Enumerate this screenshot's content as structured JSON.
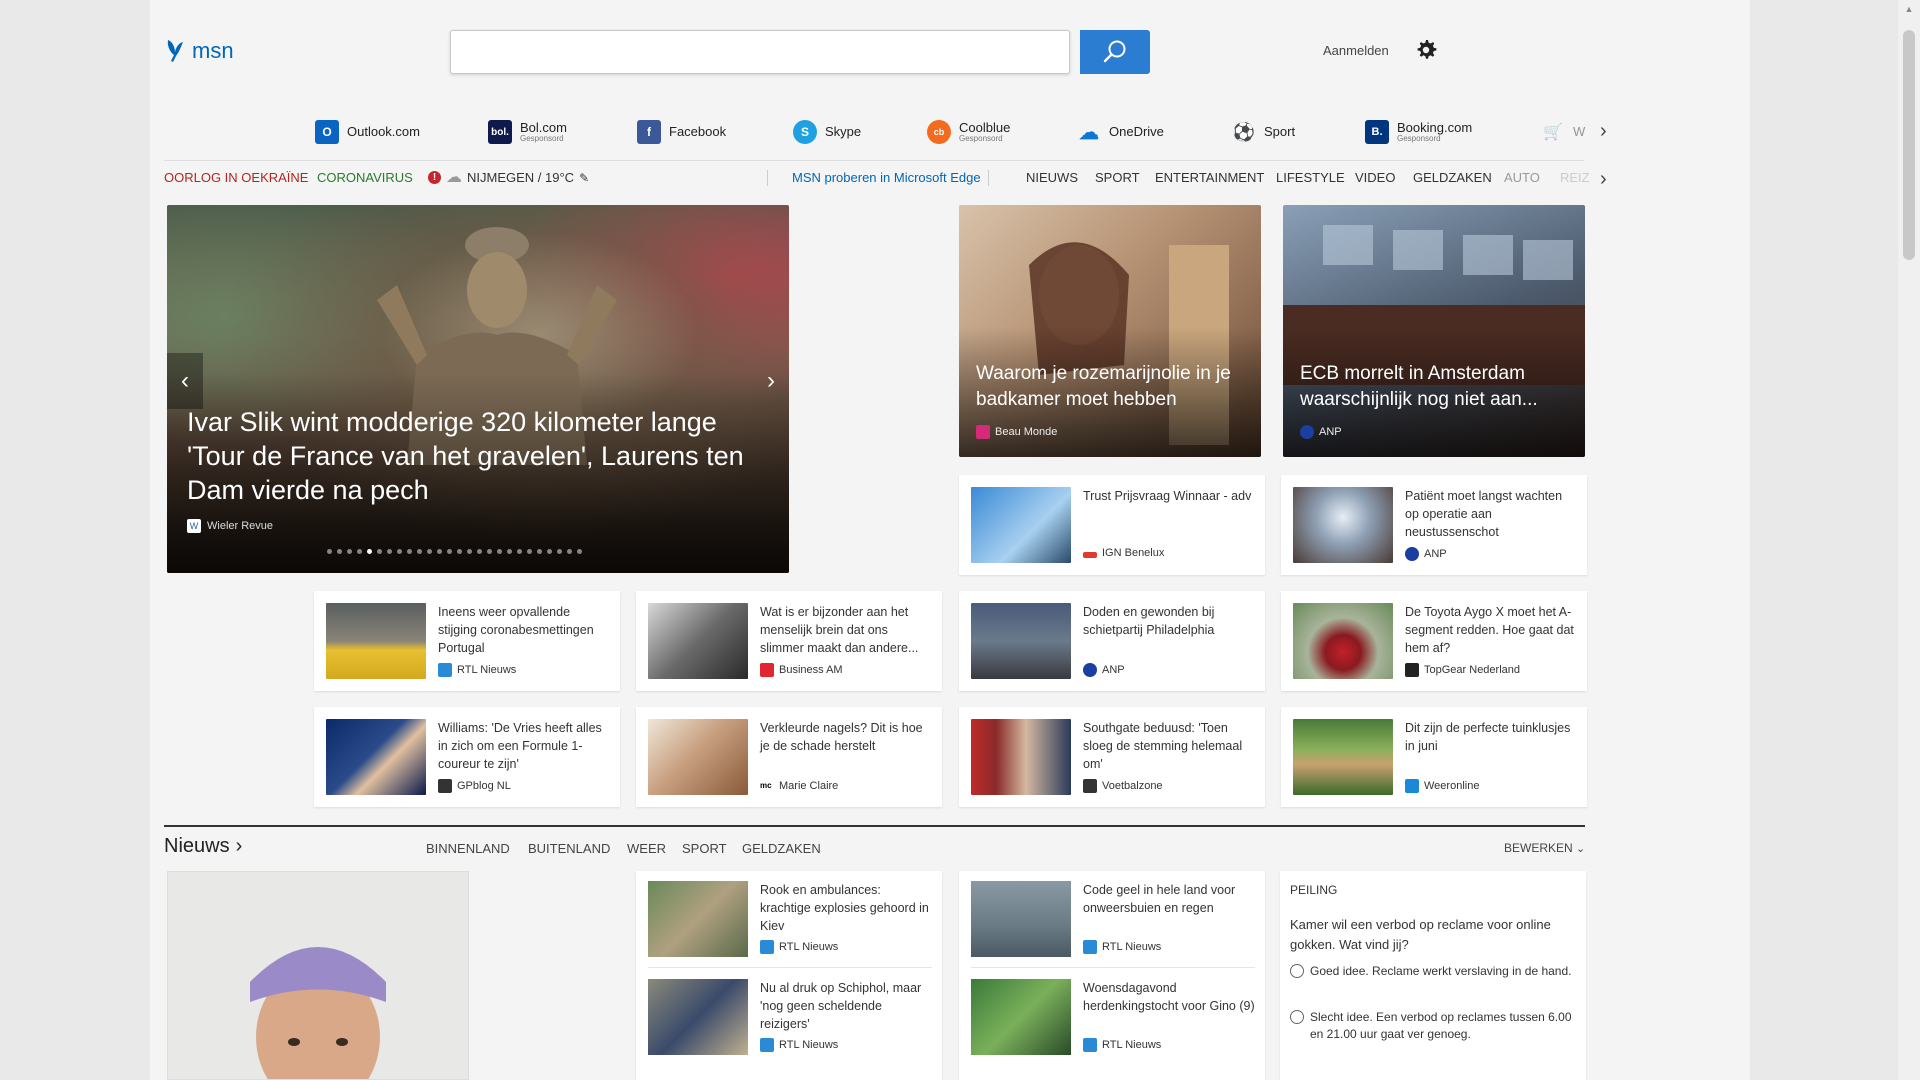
{
  "header": {
    "logo_text": "msn",
    "search_placeholder": "",
    "signin_label": "Aanmelden"
  },
  "quick_links": [
    {
      "label": "Outlook.com",
      "sub": "",
      "icon": "outlook-icon",
      "color": "#0a64c2"
    },
    {
      "label": "Bol.com",
      "sub": "Gesponsord",
      "icon": "bol-icon",
      "color": "#0e1a4d",
      "glyph": "bol."
    },
    {
      "label": "Facebook",
      "sub": "",
      "icon": "facebook-icon",
      "color": "#3b5998",
      "glyph": "f"
    },
    {
      "label": "Skype",
      "sub": "",
      "icon": "skype-icon",
      "color": "#1ea1e3",
      "glyph": "S"
    },
    {
      "label": "Coolblue",
      "sub": "Gesponsord",
      "icon": "coolblue-icon",
      "color": "#f26b1f",
      "glyph": "cb"
    },
    {
      "label": "OneDrive",
      "sub": "",
      "icon": "onedrive-icon",
      "color": "#0a78d4",
      "glyph": "☁"
    },
    {
      "label": "Sport",
      "sub": "",
      "icon": "sport-icon",
      "color": "#2a5aa8",
      "glyph": "⚽"
    },
    {
      "label": "Booking.com",
      "sub": "Gesponsord",
      "icon": "booking-icon",
      "color": "#003580",
      "glyph": "B."
    },
    {
      "label": "W",
      "sub": "",
      "icon": "cart-icon",
      "color": "#6aa6e0",
      "glyph": "🛒"
    }
  ],
  "nav": {
    "ukraine": "OORLOG IN OEKRAÏNE",
    "corona": "CORONAVIRUS",
    "weather": "NIJMEGEN / 19°C",
    "edge_promo": "MSN proberen in Microsoft Edge",
    "items": [
      "NIEUWS",
      "SPORT",
      "ENTERTAINMENT",
      "LIFESTYLE",
      "VIDEO",
      "GELDZAKEN",
      "AUTO",
      "REIZ"
    ]
  },
  "hero": {
    "title": "Ivar Slik wint modderige 320 kilometer lange 'Tour de France van het gravelen', Laurens ten Dam vierde na pech",
    "source": "Wieler Revue",
    "slide_count": 26,
    "active_slide": 4
  },
  "top_cards": [
    {
      "title": "Waarom je rozemarijnolie in je badkamer moet hebben",
      "source": "Beau Monde"
    },
    {
      "title": "ECB morrelt in Amsterdam waarschijnlijk nog niet aan...",
      "source": "ANP"
    }
  ],
  "cards": [
    {
      "title": "Trust Prijsvraag Winnaar - adv",
      "source": "IGN Benelux"
    },
    {
      "title": "Patiënt moet langst wachten op operatie aan neustussenschot",
      "source": "ANP"
    },
    {
      "title": "Ineens weer opvallende stijging coronabesmettingen Portugal",
      "source": "RTL Nieuws"
    },
    {
      "title": "Wat is er bijzonder aan het menselijk brein dat ons slimmer maakt dan andere...",
      "source": "Business AM"
    },
    {
      "title": "Doden en gewonden bij schietpartij Philadelphia",
      "source": "ANP"
    },
    {
      "title": "De Toyota Aygo X moet het A-segment redden. Hoe gaat dat hem af?",
      "source": "TopGear Nederland"
    },
    {
      "title": "Williams: 'De Vries heeft alles in zich om een Formule 1-coureur te zijn'",
      "source": "GPblog NL"
    },
    {
      "title": "Verkleurde nagels? Dit is hoe je de schade herstelt",
      "source": "Marie Claire"
    },
    {
      "title": "Southgate beduusd: 'Toen sloeg de stemming helemaal om'",
      "source": "Voetbalzone"
    },
    {
      "title": "Dit zijn de perfecte tuinklusjes in juni",
      "source": "Weeronline"
    }
  ],
  "news": {
    "heading": "Nieuws",
    "tabs": [
      "BINNENLAND",
      "BUITENLAND",
      "WEER",
      "SPORT",
      "GELDZAKEN"
    ],
    "edit_label": "BEWERKEN",
    "col1": [
      {
        "title": "Rook en ambulances: krachtige explosies gehoord in Kiev",
        "source": "RTL Nieuws"
      },
      {
        "title": "Nu al druk op Schiphol, maar 'nog geen scheldende reizigers'",
        "source": "RTL Nieuws"
      }
    ],
    "col2": [
      {
        "title": "Code geel in hele land voor onweersbuien en regen",
        "source": "RTL Nieuws"
      },
      {
        "title": "Woensdagavond herdenkingstocht voor Gino (9)",
        "source": "RTL Nieuws"
      }
    ]
  },
  "poll": {
    "heading": "PEILING",
    "question": "Kamer wil een verbod op reclame voor online gokken. Wat vind jij?",
    "options": [
      "Goed idee. Reclame werkt verslaving in de hand.",
      "Slecht idee. Een verbod op reclames tussen 6.00 en 21.00 uur gaat ver genoeg."
    ]
  }
}
